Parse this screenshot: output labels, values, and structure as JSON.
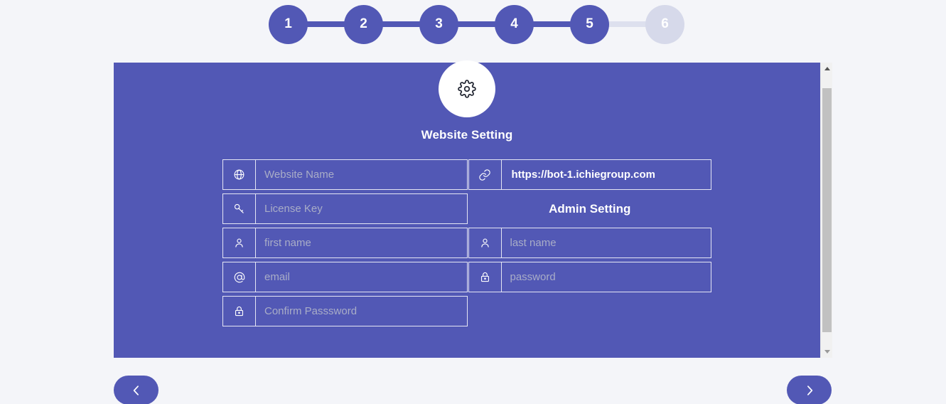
{
  "stepper": {
    "steps": [
      {
        "label": "1",
        "state": "active"
      },
      {
        "label": "2",
        "state": "active"
      },
      {
        "label": "3",
        "state": "active"
      },
      {
        "label": "4",
        "state": "active"
      },
      {
        "label": "5",
        "state": "active"
      },
      {
        "label": "6",
        "state": "inactive"
      }
    ],
    "active_color": "#5258b5",
    "inactive_color": "#d6d9ea"
  },
  "card": {
    "background_color": "#5258b5",
    "header_icon": "gear-icon",
    "title": "Website Setting",
    "admin_section_title": "Admin Setting"
  },
  "form": {
    "website_name": {
      "icon": "globe-icon",
      "placeholder": "Website Name",
      "value": "",
      "focused": true
    },
    "website_url": {
      "icon": "link-icon",
      "placeholder": "",
      "value": "https://bot-1.ichiegroup.com"
    },
    "license_key": {
      "icon": "key-icon",
      "placeholder": "License Key",
      "value": ""
    },
    "first_name": {
      "icon": "user-icon",
      "placeholder": "first name",
      "value": ""
    },
    "last_name": {
      "icon": "user-icon",
      "placeholder": "last name",
      "value": ""
    },
    "email": {
      "icon": "at-icon",
      "placeholder": "email",
      "value": ""
    },
    "password": {
      "icon": "lock-icon",
      "placeholder": "password",
      "value": ""
    },
    "confirm_password": {
      "icon": "lock-icon",
      "placeholder": "Confirm Passsword",
      "value": ""
    }
  },
  "scrollbar": {
    "up_arrow": "triangle-up-icon",
    "down_arrow": "triangle-down-icon",
    "track_color": "#f1f1f1",
    "thumb_color": "#c1c1c1"
  },
  "navigation": {
    "previous_icon": "chevron-left-icon",
    "next_icon": "chevron-right-icon",
    "button_color": "#5258b5"
  }
}
